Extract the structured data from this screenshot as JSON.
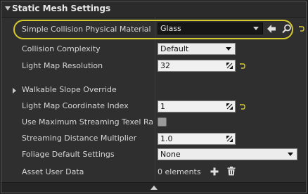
{
  "header": {
    "title": "Static Mesh Settings"
  },
  "colors": {
    "highlight": "#d6c92d",
    "reset_arrow": "#d6c92d",
    "panel": "#2f2f2f"
  },
  "rows": {
    "simple_collision": {
      "label": "Simple Collision Physical Material",
      "value": "Glass"
    },
    "collision_complexity": {
      "label": "Collision Complexity",
      "value": "Default"
    },
    "light_map_resolution": {
      "label": "Light Map Resolution",
      "value": "32"
    },
    "walkable_slope": {
      "label": "Walkable Slope Override"
    },
    "light_map_coord_index": {
      "label": "Light Map Coordinate Index",
      "value": "1"
    },
    "use_max_streaming": {
      "label": "Use Maximum Streaming Texel Ratio",
      "checked": false
    },
    "streaming_distance": {
      "label": "Streaming Distance Multiplier",
      "value": "1.0"
    },
    "foliage_default": {
      "label": "Foliage Default Settings",
      "value": "None"
    },
    "asset_user_data": {
      "label": "Asset User Data",
      "value": "0 elements"
    }
  },
  "icons": {
    "use_selected": "left-arrow-icon",
    "browse": "search-icon",
    "reset": "reset-to-default-icon",
    "add": "plus-icon",
    "delete": "trash-icon",
    "collapse": "chevron-up-icon"
  }
}
